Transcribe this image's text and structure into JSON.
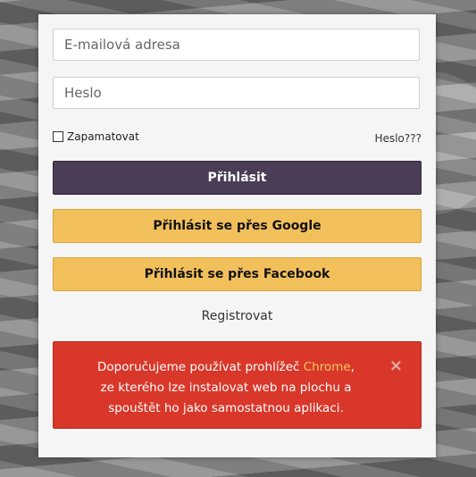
{
  "form": {
    "email_placeholder": "E-mailová adresa",
    "password_placeholder": "Heslo",
    "remember_label": "Zapamatovat",
    "forgot_label": "Heslo???",
    "login_button": "Přihlásit",
    "google_button": "Přihlásit se přes Google",
    "facebook_button": "Přihlásit se přes Facebook",
    "register_link": "Registrovat"
  },
  "alert": {
    "line1_prefix": "Doporučujeme používat prohlížeč ",
    "line1_link": "Chrome",
    "line1_suffix": ",",
    "line2": "ze kterého lze instalovat web na plochu a",
    "line3": "spouštět ho jako samostatnou aplikaci.",
    "close_symbol": "×"
  },
  "colors": {
    "login_button_bg": "#4a3d55",
    "social_button_bg": "#f2c05b",
    "alert_bg": "#d9372a",
    "alert_link": "#f4c95c"
  }
}
